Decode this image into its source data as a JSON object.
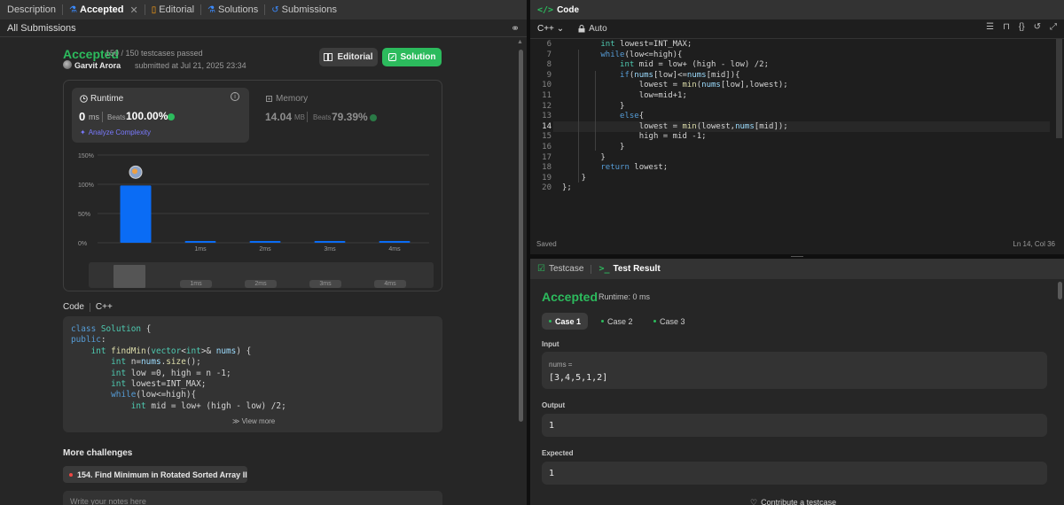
{
  "left_tabs": [
    {
      "label": "Description",
      "icon": "document-icon"
    },
    {
      "label": "Accepted",
      "icon": "flask-icon",
      "active": true
    },
    {
      "label": "Editorial",
      "icon": "book-icon"
    },
    {
      "label": "Solutions",
      "icon": "flask-icon"
    },
    {
      "label": "Submissions",
      "icon": "history-icon"
    }
  ],
  "close_glyph": "✕",
  "all_submissions": "All Submissions",
  "submission": {
    "status": "Accepted",
    "passed": "150 / 150 testcases passed",
    "user": "Garvit Arora",
    "submitted_at": "submitted at Jul 21, 2025 23:34"
  },
  "buttons": {
    "editorial": "Editorial",
    "solution": "Solution"
  },
  "runtime": {
    "label": "Runtime",
    "value": "0",
    "unit": "ms",
    "beats_label": "Beats",
    "beats_value": "100.00%",
    "analyze": "Analyze Complexity"
  },
  "memory": {
    "label": "Memory",
    "value": "14.04",
    "unit": "MB",
    "beats_label": "Beats",
    "beats_value": "79.39%"
  },
  "chart_data": {
    "type": "bar",
    "categories": [
      "0ms",
      "1ms",
      "2ms",
      "3ms",
      "4ms"
    ],
    "values": [
      98,
      3,
      3,
      3,
      3
    ],
    "tick_labels": [
      "",
      "1ms",
      "2ms",
      "3ms",
      "4ms"
    ],
    "yticks": [
      "150%",
      "100%",
      "50%",
      "0%"
    ],
    "ylim": [
      0,
      150
    ],
    "grid": true,
    "bar_color": "#0a6cf5",
    "scrubber_labels": [
      "1ms",
      "2ms",
      "3ms",
      "4ms"
    ]
  },
  "code_header": {
    "label": "Code",
    "language": "C++"
  },
  "code_preview": [
    "class Solution {",
    "public:",
    "    int findMin(vector<int>& nums) {",
    "        int n=nums.size();",
    "        int low =0, high = n -1;",
    "        int lowest=INT_MAX;",
    "        while(low<=high){",
    "            int mid = low+ (high - low) /2;"
  ],
  "view_more": "View more",
  "more_challenges": {
    "title": "More challenges",
    "item": "154. Find Minimum in Rotated Sorted Array II"
  },
  "notes_placeholder": "Write your notes here",
  "editor": {
    "tab": "Code",
    "tag": "</>",
    "language": "C++",
    "mode": "Auto",
    "line_numbers": [
      "6",
      "7",
      "8",
      "9",
      "10",
      "11",
      "12",
      "13",
      "14",
      "15",
      "16",
      "17",
      "18",
      "19",
      "20"
    ],
    "current_line": "14",
    "lines": [
      "        int lowest=INT_MAX;",
      "        while(low<=high){",
      "            int mid = low+ (high - low) /2;",
      "            if(nums[low]<=nums[mid]){",
      "                lowest = min(nums[low],lowest);",
      "                low=mid+1;",
      "            }",
      "            else{",
      "                lowest = min(lowest,nums[mid]);",
      "                high = mid -1;",
      "            }",
      "        }",
      "        return lowest;",
      "    }",
      "};"
    ],
    "saved": "Saved",
    "cursor": "Ln 14, Col 36"
  },
  "testcase": {
    "tab_testcase": "Testcase",
    "tab_result": "Test Result",
    "status": "Accepted",
    "runtime": "Runtime: 0 ms",
    "cases": [
      "Case 1",
      "Case 2",
      "Case 3"
    ],
    "input_label": "Input",
    "input_var": "nums =",
    "input_value": "[3,4,5,1,2]",
    "output_label": "Output",
    "output_value": "1",
    "expected_label": "Expected",
    "expected_value": "1",
    "contribute": "Contribute a testcase"
  },
  "colors": {
    "accent_green": "#2cbb5d",
    "accent_blue": "#0a6cf5",
    "accent_orange": "#ffa116"
  }
}
